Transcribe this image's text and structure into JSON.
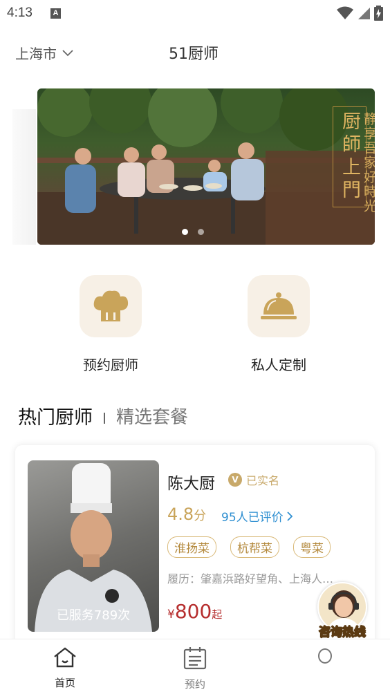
{
  "status_bar": {
    "time": "4:13",
    "notification": "A"
  },
  "header": {
    "city": "上海市",
    "title": "51厨师"
  },
  "banner": {
    "headline": "厨師上門",
    "tagline": "静享吾家好時光",
    "page_count": 2,
    "active_page": 1
  },
  "actions": [
    {
      "label": "预约厨师",
      "icon": "chef-hat-icon"
    },
    {
      "label": "私人定制",
      "icon": "cloche-icon"
    }
  ],
  "tabs": {
    "active": "热门厨师",
    "inactive": "精选套餐"
  },
  "chef": {
    "served": "已服务789次",
    "name": "陈大厨",
    "verified_badge": "V",
    "verified": "已实名",
    "rating": "4.8",
    "rating_unit": "分",
    "reviews": "95人已评价",
    "tags": [
      "淮扬菜",
      "杭帮菜",
      "粤菜"
    ],
    "resume": "履历：肇嘉浜路好望角、上海人…",
    "price_symbol": "¥",
    "price": "800",
    "price_suffix": "起"
  },
  "hotline": {
    "label": "咨询热线"
  },
  "bottom_nav": [
    {
      "label": "首页",
      "icon": "home-icon",
      "active": true
    },
    {
      "label": "预约",
      "icon": "calendar-icon",
      "active": false
    }
  ],
  "colors": {
    "accent": "#c8a96a",
    "price": "#b62e2e",
    "link": "#2f8fd1",
    "icon_bg": "#f7f0e6"
  }
}
